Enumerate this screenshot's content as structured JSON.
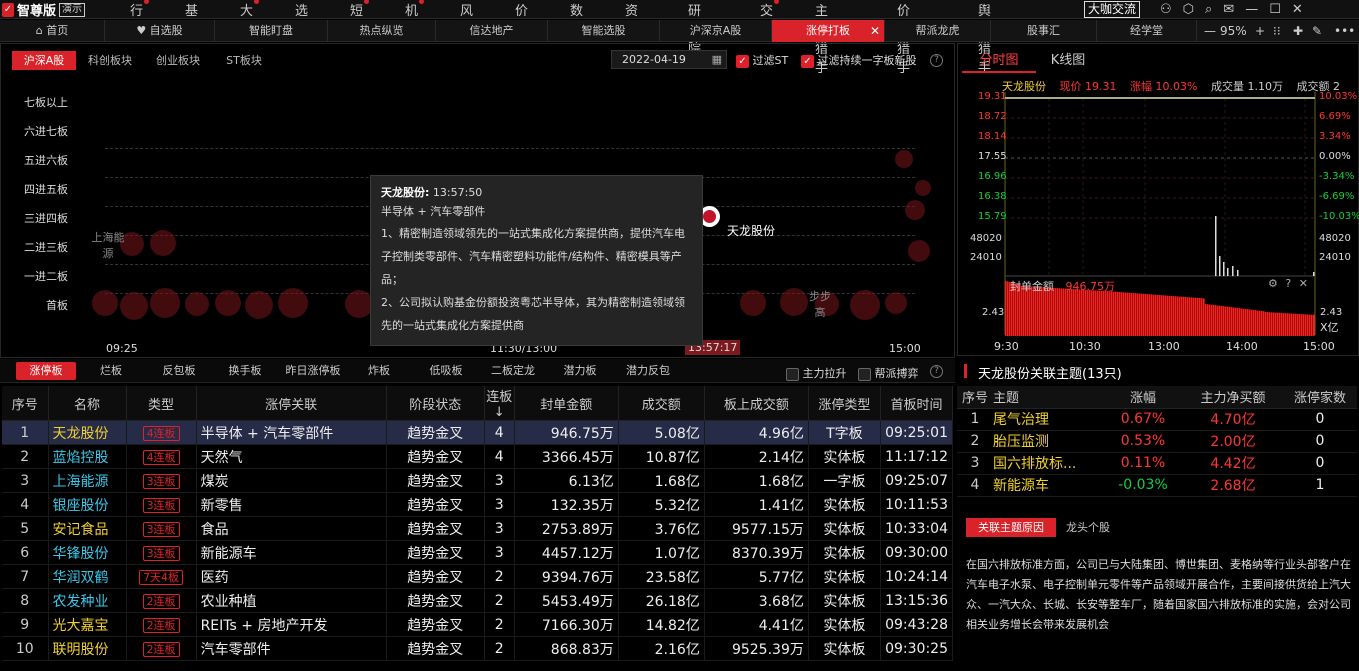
{
  "topnav": {
    "brand": "智尊版",
    "version": "演示",
    "menu": [
      {
        "label": "行情",
        "dot": true
      },
      {
        "label": "基金",
        "dot": false
      },
      {
        "label": "大盘",
        "dot": true
      },
      {
        "label": "选股",
        "dot": false
      },
      {
        "label": "短打",
        "dot": true
      },
      {
        "label": "机构",
        "dot": true
      },
      {
        "label": "风控",
        "dot": false
      },
      {
        "label": "价投",
        "dot": false
      },
      {
        "label": "数据",
        "dot": false
      },
      {
        "label": "资讯",
        "dot": false
      },
      {
        "label": "研究院",
        "dot": false
      },
      {
        "label": "交易",
        "dot": true
      },
      {
        "label": "主题猎手",
        "dot": false
      },
      {
        "label": "价值猎手",
        "dot": false
      },
      {
        "label": "舆情猎手",
        "dot": false
      }
    ],
    "special_button": "大咖交流"
  },
  "tabs": [
    {
      "label": "首页",
      "icon": "home-icon"
    },
    {
      "label": "自选股",
      "icon": "heart-icon"
    },
    {
      "label": "智能盯盘"
    },
    {
      "label": "热点纵览"
    },
    {
      "label": "信达地产"
    },
    {
      "label": "智能选股"
    },
    {
      "label": "沪深京A股"
    },
    {
      "label": "涨停打板",
      "active": true
    },
    {
      "label": "帮派龙虎"
    },
    {
      "label": "股事汇"
    },
    {
      "label": "经学堂"
    }
  ],
  "zoom": "95%",
  "market_tabs": [
    "沪深A股",
    "科创板块",
    "创业板块",
    "ST板块"
  ],
  "date": "2022-04-19",
  "filters": {
    "filter_st": "过滤ST",
    "filter_oneword": "过滤持续一字板新股"
  },
  "levels": [
    "七板以上",
    "六进七板",
    "五进六板",
    "四进五板",
    "三进四板",
    "二进三板",
    "一进二板",
    "首板"
  ],
  "bubble_chart": {
    "x_ticks": [
      "09:25",
      "11:30/13:00",
      "13:57:17",
      "15:00"
    ],
    "labels": {
      "tianlong": "天龙股份",
      "shanghai": "上海能源",
      "bubu": "步步高"
    }
  },
  "tooltip": {
    "title": "天龙股份:",
    "time": "13:57:50",
    "theme": "半导体 + 汽车零部件",
    "line1": "1、精密制造领域领先的一站式集成化方案提供商，提供汽车电子控制类零部件、汽车精密塑料功能件/结构件、精密模具等产品；",
    "line2": "2、公司拟认购基金份额投资粤芯半导体，其为精密制造领域领先的一站式集成化方案提供商"
  },
  "subtabs": [
    "涨停板",
    "烂板",
    "反包板",
    "换手板",
    "昨日涨停板",
    "炸板",
    "低吸板",
    "二板定龙",
    "潜力板",
    "潜力反包"
  ],
  "checks": {
    "main_pull": "主力拉升",
    "gang_fight": "帮派搏弈"
  },
  "table": {
    "headers": [
      "序号",
      "名称",
      "类型",
      "涨停关联",
      "阶段状态",
      "连板↓",
      "封单金额",
      "成交额",
      "板上成交额",
      "涨停类型",
      "首板时间"
    ],
    "rows": [
      {
        "no": "1",
        "name": "天龙股份",
        "color": "yel",
        "type": "4连板",
        "theme": "半导体 + 汽车零部件",
        "stage": "趋势金叉",
        "lb": "4",
        "seal": "946.75万",
        "amt": "5.08亿",
        "board": "4.96亿",
        "ztype": "T字板",
        "time": "09:25:01"
      },
      {
        "no": "2",
        "name": "蓝焰控股",
        "color": "cyan",
        "type": "4连板",
        "theme": "天然气",
        "stage": "趋势金叉",
        "lb": "4",
        "seal": "3366.45万",
        "amt": "10.87亿",
        "board": "2.14亿",
        "ztype": "实体板",
        "time": "11:17:12"
      },
      {
        "no": "3",
        "name": "上海能源",
        "color": "cyan",
        "type": "3连板",
        "theme": "煤炭",
        "stage": "趋势金叉",
        "lb": "3",
        "seal": "6.13亿",
        "amt": "1.68亿",
        "board": "1.68亿",
        "ztype": "一字板",
        "time": "09:25:07"
      },
      {
        "no": "4",
        "name": "银座股份",
        "color": "cyan",
        "type": "3连板",
        "theme": "新零售",
        "stage": "趋势金叉",
        "lb": "3",
        "seal": "132.35万",
        "amt": "5.32亿",
        "board": "1.41亿",
        "ztype": "实体板",
        "time": "10:11:53"
      },
      {
        "no": "5",
        "name": "安记食品",
        "color": "yel",
        "type": "3连板",
        "theme": "食品",
        "stage": "趋势金叉",
        "lb": "3",
        "seal": "2753.89万",
        "amt": "3.76亿",
        "board": "9577.15万",
        "ztype": "实体板",
        "time": "10:33:04"
      },
      {
        "no": "6",
        "name": "华锋股份",
        "color": "cyan",
        "type": "3连板",
        "theme": "新能源车",
        "stage": "趋势金叉",
        "lb": "3",
        "seal": "4457.12万",
        "amt": "1.07亿",
        "board": "8370.39万",
        "ztype": "实体板",
        "time": "09:30:00"
      },
      {
        "no": "7",
        "name": "华润双鹤",
        "color": "cyan",
        "type": "7天4板",
        "theme": "医药",
        "stage": "趋势金叉",
        "lb": "2",
        "seal": "9394.76万",
        "amt": "23.58亿",
        "board": "5.77亿",
        "ztype": "实体板",
        "time": "10:24:14"
      },
      {
        "no": "8",
        "name": "农发种业",
        "color": "cyan",
        "type": "2连板",
        "theme": "农业种植",
        "stage": "趋势金叉",
        "lb": "2",
        "seal": "5453.49万",
        "amt": "26.18亿",
        "board": "3.68亿",
        "ztype": "实体板",
        "time": "13:15:36"
      },
      {
        "no": "9",
        "name": "光大嘉宝",
        "color": "yel",
        "type": "2连板",
        "theme": "REITs + 房地产开发",
        "stage": "趋势金叉",
        "lb": "2",
        "seal": "7166.30万",
        "amt": "14.82亿",
        "board": "4.41亿",
        "ztype": "实体板",
        "time": "09:43:28"
      },
      {
        "no": "10",
        "name": "联明股份",
        "color": "yel",
        "type": "2连板",
        "theme": "汽车零部件",
        "stage": "趋势金叉",
        "lb": "2",
        "seal": "868.83万",
        "amt": "2.16亿",
        "board": "9525.39万",
        "ztype": "实体板",
        "time": "09:30:25"
      }
    ]
  },
  "right": {
    "tabs": [
      "分时图",
      "K线图"
    ],
    "stock": "天龙股份",
    "price_label": "现价",
    "price": "19.31",
    "change_label": "涨幅",
    "change": "10.03%",
    "vol_label": "成交量",
    "vol": "1.10万",
    "amt_label": "成交额",
    "amt": "2",
    "price_ticks": [
      "19.31",
      "18.72",
      "18.14",
      "17.55",
      "16.96",
      "16.38",
      "15.79"
    ],
    "pct_ticks": [
      "10.03%",
      "6.69%",
      "3.34%",
      "0.00%",
      "-3.34%",
      "-6.69%",
      "-10.03%"
    ],
    "vol_ticks": [
      "48020",
      "24010"
    ],
    "seal_label": "封单金额",
    "seal_value": "946.75万",
    "seal_tick": "2.43",
    "seal_unit": "X亿",
    "time_ticks": [
      "9:30",
      "10:30",
      "13:00",
      "14:00",
      "15:00"
    ],
    "theme_title": "天龙股份关联主题(13只)",
    "theme_headers": [
      "序号",
      "主题",
      "涨幅",
      "主力净买额",
      "涨停家数"
    ],
    "themes": [
      {
        "no": "1",
        "name": "尾气治理",
        "chg": "0.67%",
        "chg_c": "red",
        "net": "4.70亿",
        "cnt": "0"
      },
      {
        "no": "2",
        "name": "胎压监测",
        "chg": "0.53%",
        "chg_c": "red",
        "net": "2.00亿",
        "cnt": "0"
      },
      {
        "no": "3",
        "name": "国六排放标...",
        "chg": "0.11%",
        "chg_c": "red",
        "net": "4.42亿",
        "cnt": "0"
      },
      {
        "no": "4",
        "name": "新能源车",
        "chg": "-0.03%",
        "chg_c": "grn",
        "net": "2.68亿",
        "cnt": "1"
      }
    ],
    "reason_tabs": [
      "关联主题原因",
      "龙头个股"
    ],
    "reason_text": "在国六排放标准方面，公司已与大陆集团、博世集团、麦格纳等行业头部客户在汽车电子水泵、电子控制单元零件等产品领域开展合作，主要间接供货给上汽大众、一汽大众、长城、长安等整车厂，随着国家国六排放标准的实施，会对公司相关业务增长会带来发展机会"
  },
  "colors": {
    "accent": "#d9222a",
    "up": "#ff3535",
    "down": "#10d040",
    "highlight": "#f0d030"
  }
}
